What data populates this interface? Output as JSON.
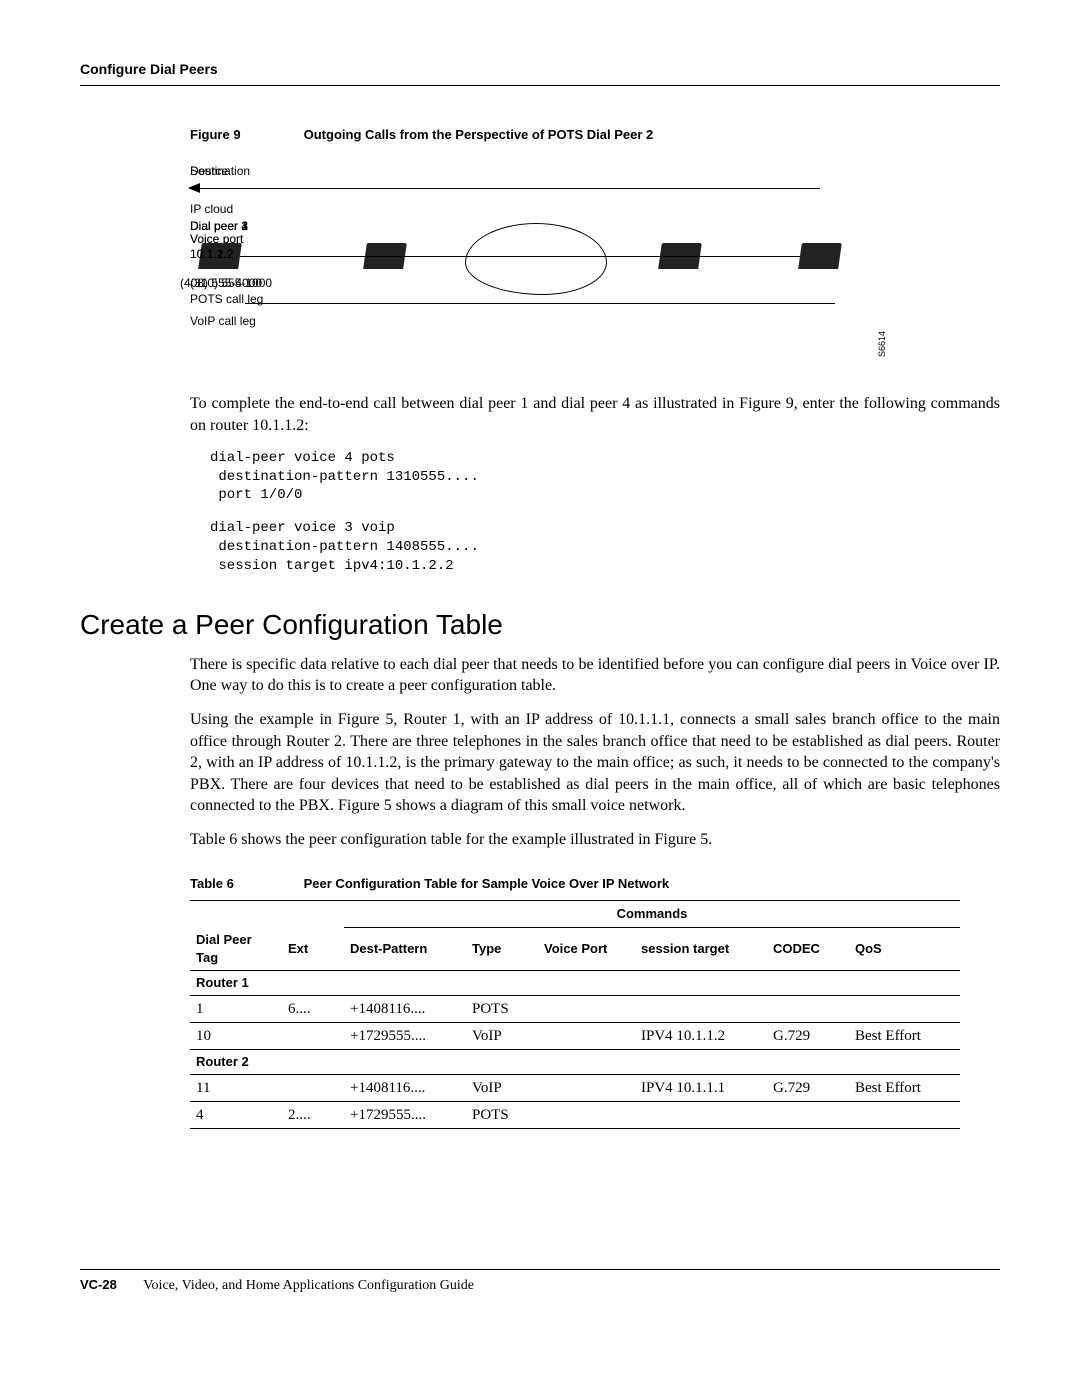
{
  "header": {
    "title": "Configure Dial Peers"
  },
  "figure": {
    "label": "Figure 9",
    "title": "Outgoing Calls from the Perspective of POTS Dial Peer 2",
    "labels": {
      "destination": "Destination",
      "source": "Source",
      "ip_cloud": "IP cloud",
      "dp1": "Dial peer 1",
      "dp2": "Dial peer 2",
      "dp3": "Dial peer 3",
      "dp4": "Dial peer 4",
      "voice_port_left": "Voice port\n1/0/0",
      "voice_port_right": "Voice port\n1/0/0",
      "ip_left": "10.1.2.2",
      "ip_right": "10.1.1.2",
      "phone_left": "(408) 555-4000",
      "phone_right": "(310) 555-1000",
      "voip_leg": "VoIP call leg",
      "pots_leg": "POTS call leg",
      "diagram_id": "S6614"
    }
  },
  "para1": "To complete the end-to-end call between dial peer 1 and dial peer 4 as illustrated in Figure 9, enter the following commands on router 10.1.1.2:",
  "code1": "dial-peer voice 4 pots\n destination-pattern 1310555....\n port 1/0/0",
  "code2": "dial-peer voice 3 voip\n destination-pattern 1408555....\n session target ipv4:10.1.2.2",
  "heading2": "Create a Peer Configuration Table",
  "para2": "There is specific data relative to each dial peer that needs to be identified before you can configure dial peers in Voice over IP. One way to do this is to create a peer configuration table.",
  "para3": "Using the example in Figure 5, Router 1, with an IP address of 10.1.1.1, connects a small sales branch office to the main office through Router 2. There are three telephones in the sales branch office that need to be established as dial peers. Router 2, with an IP address of 10.1.1.2, is the primary gateway to the main office; as such, it needs to be connected to the company's PBX. There are four devices that need to be established as dial peers in the main office, all of which are basic telephones connected to the PBX. Figure 5 shows a diagram of this small voice network.",
  "para4": "Table 6 shows the peer configuration table for the example illustrated in Figure 5.",
  "table": {
    "label": "Table 6",
    "title": "Peer Configuration Table for Sample Voice Over IP Network",
    "group_header": "Commands",
    "columns": [
      "Dial Peer Tag",
      "Ext",
      "Dest-Pattern",
      "Type",
      "Voice Port",
      "session target",
      "CODEC",
      "QoS"
    ],
    "sections": [
      {
        "router": "Router 1",
        "rows": [
          {
            "tag": "1",
            "ext": "6....",
            "dest": "+1408116....",
            "type": "POTS",
            "voice": "",
            "target": "",
            "codec": "",
            "qos": ""
          },
          {
            "tag": "10",
            "ext": "",
            "dest": "+1729555....",
            "type": "VoIP",
            "voice": "",
            "target": "IPV4 10.1.1.2",
            "codec": "G.729",
            "qos": "Best Effort"
          }
        ]
      },
      {
        "router": "Router 2",
        "rows": [
          {
            "tag": "11",
            "ext": "",
            "dest": "+1408116....",
            "type": "VoIP",
            "voice": "",
            "target": "IPV4 10.1.1.1",
            "codec": "G.729",
            "qos": "Best Effort"
          },
          {
            "tag": "4",
            "ext": "2....",
            "dest": "+1729555....",
            "type": "POTS",
            "voice": "",
            "target": "",
            "codec": "",
            "qos": ""
          }
        ]
      }
    ]
  },
  "footer": {
    "page": "VC-28",
    "doc": "Voice, Video, and Home Applications Configuration Guide"
  }
}
